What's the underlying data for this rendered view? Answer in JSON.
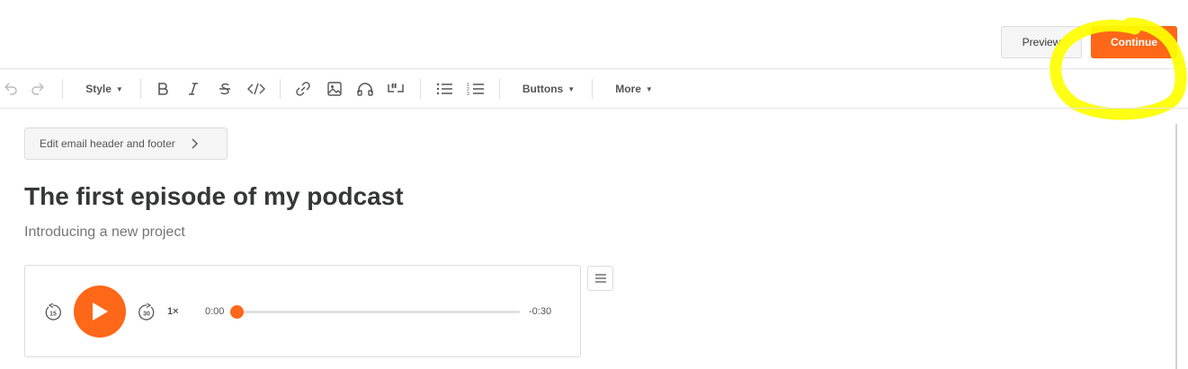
{
  "header": {
    "preview_label": "Preview",
    "continue_label": "Continue"
  },
  "toolbar": {
    "style_label": "Style",
    "buttons_label": "Buttons",
    "more_label": "More",
    "icons": [
      "undo-icon",
      "redo-icon",
      "bold-icon",
      "italic-icon",
      "strikethrough-icon",
      "code-icon",
      "link-icon",
      "image-icon",
      "audio-icon",
      "quote-icon",
      "bullet-list-icon",
      "numbered-list-icon"
    ]
  },
  "editor": {
    "edit_header_label": "Edit email header and footer",
    "title": "The first episode of my podcast",
    "subtitle": "Introducing a new project"
  },
  "player": {
    "skip_back": "15",
    "skip_forward": "30",
    "speed": "1×",
    "current_time": "0:00",
    "remaining_time": "-0:30",
    "progress": 0
  },
  "colors": {
    "accent": "#ff6719",
    "highlight": "#ffff00"
  }
}
